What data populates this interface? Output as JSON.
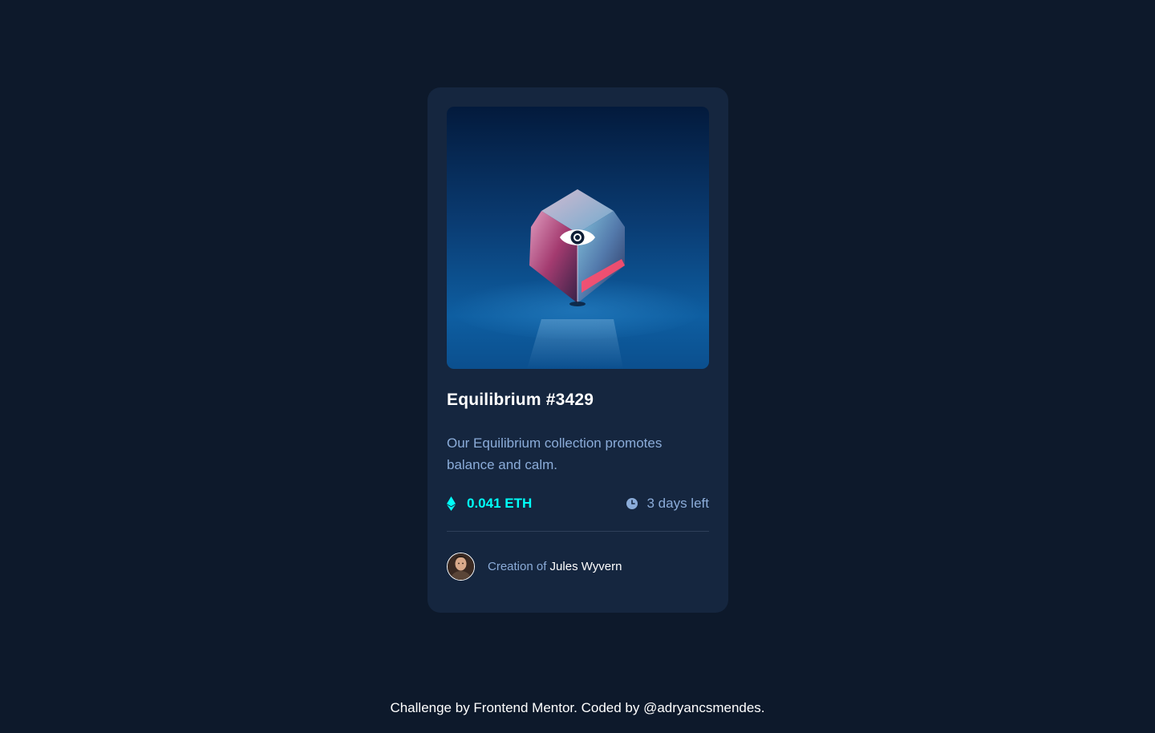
{
  "card": {
    "title": "Equilibrium #3429",
    "description": "Our Equilibrium collection promotes balance and calm.",
    "price": "0.041 ETH",
    "time_left": "3 days left",
    "creator_prefix": "Creation of",
    "creator_name": "Jules Wyvern"
  },
  "footer": {
    "text": "Challenge by Frontend Mentor. Coded by @adryancsmendes."
  },
  "icons": {
    "image_overlay": "eye-icon",
    "price": "ethereum-icon",
    "time": "clock-icon"
  },
  "colors": {
    "page_bg": "#0d192b",
    "card_bg": "#15263f",
    "accent_cyan": "#00fff8",
    "soft_blue": "#8bacd9",
    "divider": "#2e405a",
    "white": "#ffffff"
  }
}
